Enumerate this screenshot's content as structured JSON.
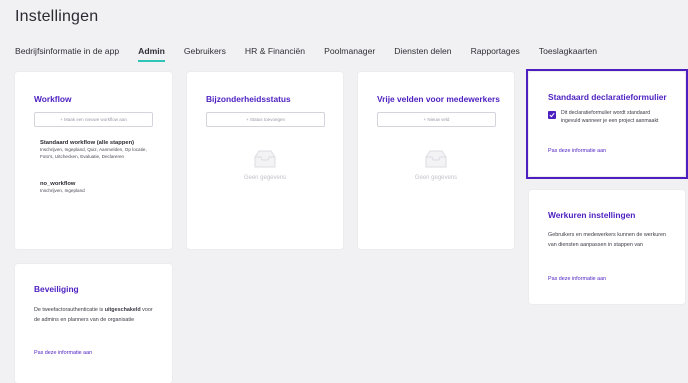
{
  "page": {
    "title": "Instellingen"
  },
  "tabs": [
    {
      "label": "Bedrijfsinformatie in de app"
    },
    {
      "label": "Admin"
    },
    {
      "label": "Gebruikers"
    },
    {
      "label": "HR & Financiën"
    },
    {
      "label": "Poolmanager"
    },
    {
      "label": "Diensten delen"
    },
    {
      "label": "Rapportages"
    },
    {
      "label": "Toeslagkaarten"
    }
  ],
  "active_tab": "Admin",
  "workflow": {
    "title": "Workflow",
    "add_button": "+ Maak een nieuwe workflow aan",
    "items": [
      {
        "name": "Standaard workflow (alle stappen)",
        "description": "Inschrijven, Ingepland, Quiz, Aanmelden, Op locatie, Foto's, Uitchecken, Evaluatie, Declareren"
      },
      {
        "name": "no_workflow",
        "description": "Inschrijven, Ingepland"
      }
    ]
  },
  "bijzonderheidsstatus": {
    "title": "Bijzonderheidsstatus",
    "add_button": "+ Status toevoegen",
    "empty_text": "Geen gegevens"
  },
  "vrije_velden": {
    "title": "Vrije velden voor medewerkers",
    "add_button": "+ Nieuw veld",
    "empty_text": "Geen gegevens"
  },
  "declaratieformulier": {
    "title": "Standaard declaratieformulier",
    "checkbox_label": "Dit declaratieformulier wordt standaard ingevuld wanneer je een project aanmaakt",
    "checked": true,
    "link": "Pas deze informatie aan"
  },
  "werkuren": {
    "title": "Werkuren instellingen",
    "text": "Gebruikers en medewerkers kunnen de werkuren van diensten aanpassen in stappen van",
    "link": "Pas deze informatie aan"
  },
  "beveiliging": {
    "title": "Beveiliging",
    "text_before": "De tweefactorauthenticatie is ",
    "text_bold": "uitgeschakeld",
    "text_after": " voor de admins en planners van de organisatie",
    "link": "Pas deze informatie aan"
  },
  "colors": {
    "accent": "#4b1fc0",
    "tab_underline": "#2ec4b6",
    "background": "#f1f1f4"
  }
}
